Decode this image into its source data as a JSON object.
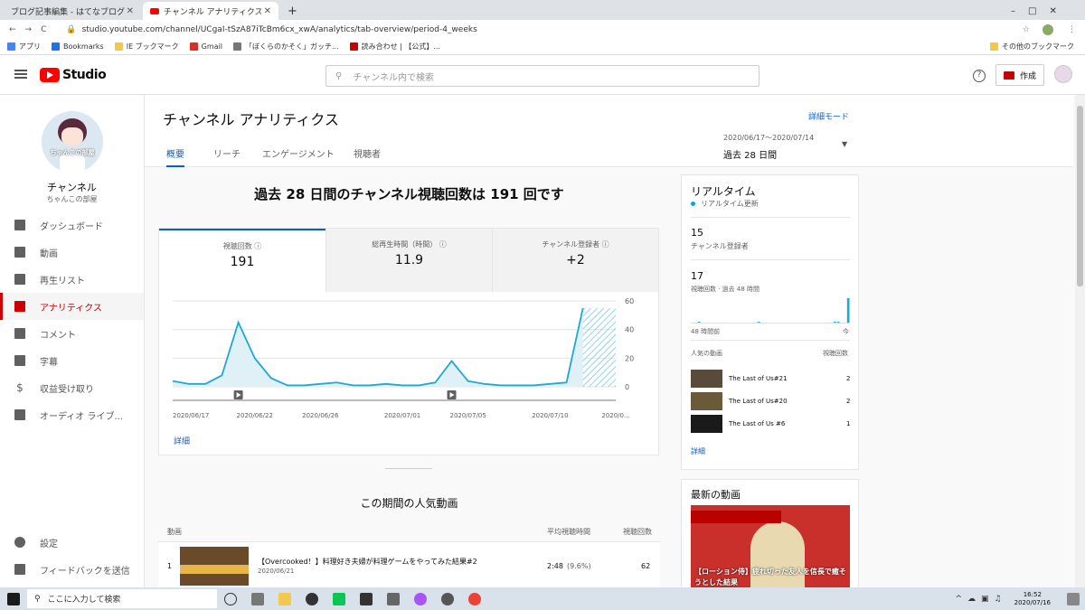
{
  "browser": {
    "tabs": [
      {
        "title": "ブログ記事編集 - はてなブログ"
      },
      {
        "title": "チャンネル アナリティクス - YouTube Studio"
      }
    ],
    "url": "studio.youtube.com/channel/UCgaI-tSzA87iTcBm6cx_xwA/analytics/tab-overview/period-4_weeks",
    "bookmarks": [
      "アプリ",
      "Bookmarks",
      "IE ブックマーク",
      "Gmail",
      "「ぼくらのかそく」ガッチ...",
      "読み合わせ | 【公式】...",
      "その他のブックマーク"
    ]
  },
  "studio": {
    "logo": "Studio",
    "search_placeholder": "チャンネル内で検索",
    "create_label": "作成"
  },
  "sidebar": {
    "avatar_text": "ちゃんこの部屋",
    "channel_title": "チャンネル",
    "channel_name": "ちゃんこの部屋",
    "items": [
      {
        "label": "ダッシュボード"
      },
      {
        "label": "動画"
      },
      {
        "label": "再生リスト"
      },
      {
        "label": "アナリティクス"
      },
      {
        "label": "コメント"
      },
      {
        "label": "字幕"
      },
      {
        "label": "収益受け取り"
      },
      {
        "label": "オーディオ ライブ..."
      }
    ],
    "bottom": [
      {
        "label": "設定"
      },
      {
        "label": "フィードバックを送信"
      }
    ]
  },
  "page": {
    "title": "チャンネル アナリティクス",
    "advanced": "詳細モード",
    "tabs": [
      "概要",
      "リーチ",
      "エンゲージメント",
      "視聴者"
    ],
    "date_range": "2020/06/17〜2020/07/14",
    "period": "過去 28 日間",
    "headline": "過去 28 日間のチャンネル視聴回数は 191 回です"
  },
  "metrics": [
    {
      "label": "視聴回数",
      "value": "191"
    },
    {
      "label": "総再生時間（時間）",
      "value": "11.9"
    },
    {
      "label": "チャンネル登録者",
      "value": "+2"
    }
  ],
  "chart_data": {
    "type": "area",
    "x_tick_labels": [
      "2020/06/17",
      "2020/06/22",
      "2020/06/26",
      "2020/07/01",
      "2020/07/05",
      "2020/07/10",
      "2020/0..."
    ],
    "y_ticks": [
      0,
      20,
      40,
      60
    ],
    "ylim": [
      0,
      60
    ],
    "values": [
      4,
      2,
      2,
      8,
      45,
      20,
      6,
      1,
      1,
      2,
      3,
      1,
      1,
      2,
      1,
      1,
      3,
      18,
      4,
      2,
      1,
      1,
      1,
      2,
      3,
      55,
      55,
      55
    ],
    "detail_link": "詳細"
  },
  "realtime": {
    "title": "リアルタイム",
    "subtitle": "リアルタイム更新",
    "subs_value": "15",
    "subs_label": "チャンネル登録者",
    "views_value": "17",
    "views_label": "視聴回数 · 過去 48 時間",
    "spark_left": "48 時間前",
    "spark_right": "今",
    "spark_values": [
      0,
      0,
      1,
      0,
      0,
      0,
      0,
      0,
      0,
      0,
      0,
      0,
      0,
      0,
      0,
      0,
      0,
      0,
      0,
      0,
      1,
      0,
      0,
      0,
      0,
      0,
      0,
      0,
      0,
      0,
      0,
      0,
      0,
      0,
      0,
      0,
      0,
      0,
      0,
      0,
      0,
      0,
      0,
      1,
      1,
      0,
      0,
      14
    ],
    "top_label": "人気の動画",
    "top_views_label": "視聴回数",
    "videos": [
      {
        "title": "The Last of Us#21",
        "views": "2"
      },
      {
        "title": "The Last of Us#20",
        "views": "2"
      },
      {
        "title": "The Last of Us #6",
        "views": "1"
      }
    ],
    "detail": "詳細"
  },
  "latest": {
    "title": "最新の動画",
    "thumb_caption": "【ローション侍】疲れ切った友人を信長で癒そうとした結果"
  },
  "popular": {
    "title": "この期間の人気動画",
    "col_video": "動画",
    "col_avg": "平均視聴時間",
    "col_views": "視聴回数",
    "rows": [
      {
        "rank": "1",
        "title": "【Overcooked！】料理好き夫婦が料理ゲームをやってみた結果#2",
        "date": "2020/06/21",
        "avg": "2:48",
        "pct": "(9.6%)",
        "views": "62"
      }
    ]
  },
  "taskbar": {
    "search": "ここに入力して検索",
    "time": "16:52",
    "date": "2020/07/16"
  }
}
